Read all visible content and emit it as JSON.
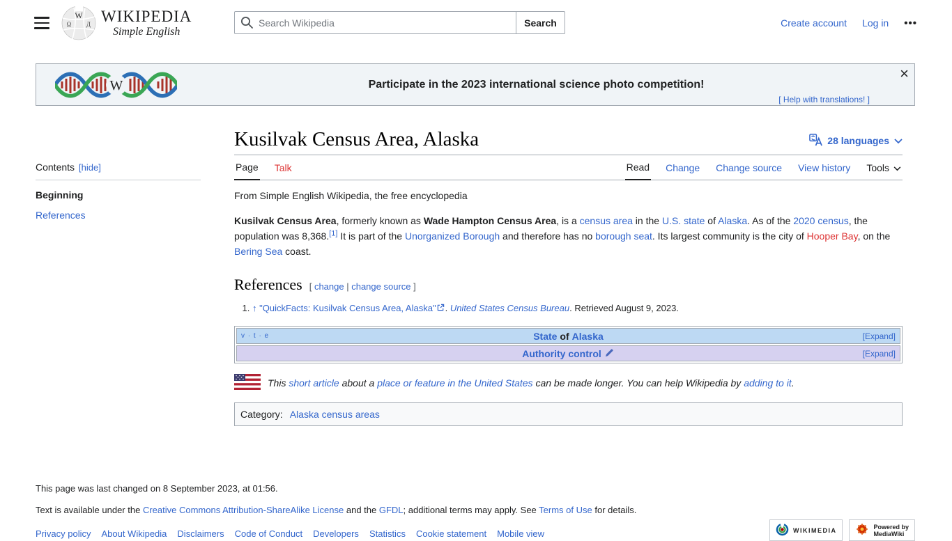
{
  "colors": {
    "link": "#3366cc",
    "red_link": "#dd3333",
    "text": "#202122",
    "border": "#a2a9b1",
    "banner_background": "#f0f4f7",
    "navbox_blue": "#bdd9f3",
    "navbox_purple": "#d6d1f0"
  },
  "header": {
    "logo_title": "WIKIPEDIA",
    "logo_subtitle": "Simple English",
    "search_placeholder": "Search Wikipedia",
    "search_button": "Search",
    "create_account": "Create account",
    "log_in": "Log in",
    "more_menu": "•••"
  },
  "banner": {
    "message": "Participate in the 2023 international science photo competition!",
    "help_link": "[ Help with translations! ]",
    "close": "×"
  },
  "sidebar": {
    "contents_label": "Contents",
    "hide_label": "[hide]",
    "items": {
      "beginning": "Beginning",
      "references": "References"
    }
  },
  "article": {
    "title": "Kusilvak Census Area, Alaska",
    "languages_label": "28 languages",
    "tabs": {
      "page": "Page",
      "talk": "Talk",
      "read": "Read",
      "change": "Change",
      "change_source": "Change source",
      "view_history": "View history",
      "tools": "Tools"
    },
    "tagline": "From Simple English Wikipedia, the free encyclopedia",
    "lead_segments": [
      {
        "text": "Kusilvak Census Area",
        "style": "bold"
      },
      {
        "text": ", formerly known as ",
        "style": "plain"
      },
      {
        "text": "Wade Hampton Census Area",
        "style": "bold"
      },
      {
        "text": ", is a ",
        "style": "plain"
      },
      {
        "text": "census area",
        "style": "link"
      },
      {
        "text": " in the ",
        "style": "plain"
      },
      {
        "text": "U.S. state",
        "style": "link"
      },
      {
        "text": " of ",
        "style": "plain"
      },
      {
        "text": "Alaska",
        "style": "link"
      },
      {
        "text": ". As of the ",
        "style": "plain"
      },
      {
        "text": "2020 census",
        "style": "link"
      },
      {
        "text": ", the population was 8,368.",
        "style": "plain"
      },
      {
        "text": "[1]",
        "style": "sup-link"
      },
      {
        "text": " It is part of the ",
        "style": "plain"
      },
      {
        "text": "Unorganized Borough",
        "style": "link"
      },
      {
        "text": " and therefore has no ",
        "style": "plain"
      },
      {
        "text": "borough seat",
        "style": "link"
      },
      {
        "text": ". Its largest community is the city of ",
        "style": "plain"
      },
      {
        "text": "Hooper Bay",
        "style": "redlink"
      },
      {
        "text": ", on the ",
        "style": "plain"
      },
      {
        "text": "Bering Sea",
        "style": "link"
      },
      {
        "text": " coast.",
        "style": "plain"
      }
    ],
    "references_heading": "References",
    "references_edit_segments": [
      {
        "text": "[ ",
        "style": "plain-gray"
      },
      {
        "text": "change",
        "style": "link"
      },
      {
        "text": " | ",
        "style": "plain-gray"
      },
      {
        "text": "change source",
        "style": "link"
      },
      {
        "text": " ]",
        "style": "plain-gray"
      }
    ],
    "reference_segments": [
      {
        "text": "↑ ",
        "style": "link"
      },
      {
        "text": "\"QuickFacts: Kusilvak Census Area, Alaska\"",
        "style": "link"
      },
      {
        "icon": "external-link"
      },
      {
        "text": ". ",
        "style": "plain"
      },
      {
        "text": "United States Census Bureau",
        "style": "link-italic"
      },
      {
        "text": ". Retrieved August 9, 2023.",
        "style": "plain"
      }
    ]
  },
  "navboxes": {
    "vte": "v · t · e",
    "expand_label": "[Expand]",
    "alaska_title_segments": [
      {
        "text": "State",
        "style": "link-bold"
      },
      {
        "text": " of ",
        "style": "bold"
      },
      {
        "text": "Alaska",
        "style": "link-bold"
      }
    ],
    "authority_title_segments": [
      {
        "text": "Authority control ",
        "style": "link-bold"
      },
      {
        "icon": "pencil"
      }
    ]
  },
  "stub": {
    "segments": [
      {
        "text": "This ",
        "style": "plain"
      },
      {
        "text": "short article",
        "style": "link"
      },
      {
        "text": " about a ",
        "style": "plain"
      },
      {
        "text": "place or feature in the United States",
        "style": "link"
      },
      {
        "text": " can be made longer. You can help Wikipedia by ",
        "style": "plain"
      },
      {
        "text": "adding to it",
        "style": "link"
      },
      {
        "text": ".",
        "style": "plain"
      }
    ]
  },
  "category": {
    "label": "Category:",
    "link": "Alaska census areas"
  },
  "footer": {
    "last_changed": "This page was last changed on 8 September 2023, at 01:56.",
    "license_segments": [
      {
        "text": "Text is available under the ",
        "style": "plain"
      },
      {
        "text": "Creative Commons Attribution-ShareAlike License",
        "style": "link"
      },
      {
        "text": " and the ",
        "style": "plain"
      },
      {
        "text": "GFDL",
        "style": "link"
      },
      {
        "text": "; additional terms may apply. See ",
        "style": "plain"
      },
      {
        "text": "Terms of Use",
        "style": "link"
      },
      {
        "text": " for details.",
        "style": "plain"
      }
    ],
    "links": [
      "Privacy policy",
      "About Wikipedia",
      "Disclaimers",
      "Code of Conduct",
      "Developers",
      "Statistics",
      "Cookie statement",
      "Mobile view"
    ],
    "badges": {
      "wikimedia": "WIKIMEDIA",
      "mediawiki_line1": "Powered by",
      "mediawiki_line2": "MediaWiki"
    }
  }
}
